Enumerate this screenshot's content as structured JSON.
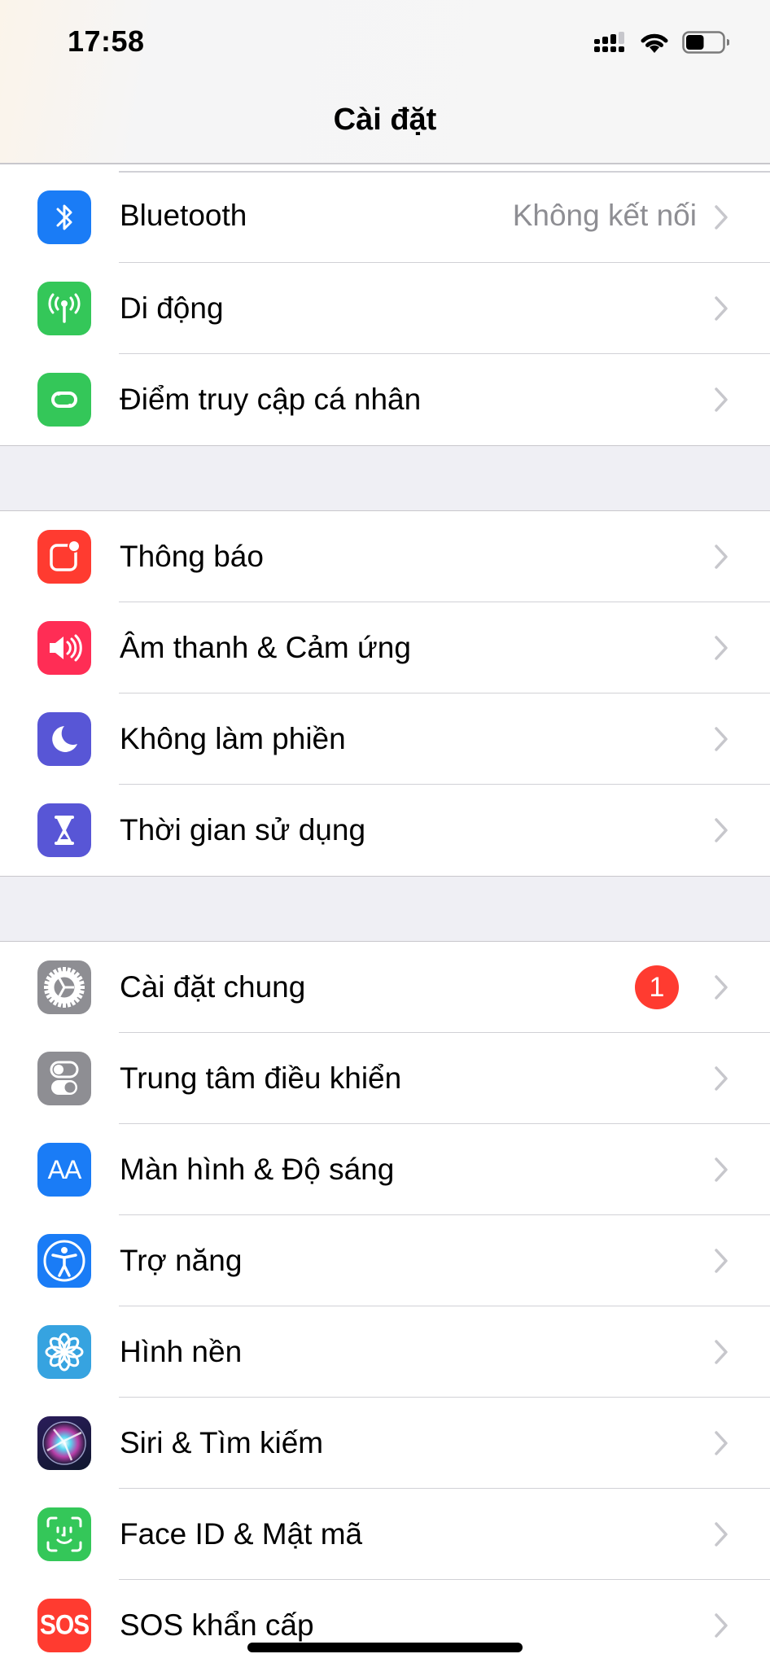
{
  "status_bar": {
    "time": "17:58",
    "signal_bars_active": 3,
    "signal_bars_total": 4,
    "battery_level": 0.5
  },
  "nav": {
    "title": "Cài đặt"
  },
  "sections": [
    {
      "rows": [
        {
          "label": "Bluetooth",
          "detail": "Không kết nối",
          "icon": "bluetooth-icon",
          "color": "#1a7cf6"
        },
        {
          "label": "Di động",
          "icon": "antenna-icon",
          "color": "#34c759"
        },
        {
          "label": "Điểm truy cập cá nhân",
          "icon": "hotspot-link-icon",
          "color": "#34c759"
        }
      ]
    },
    {
      "rows": [
        {
          "label": "Thông báo",
          "icon": "notifications-icon",
          "color": "#ff3b30"
        },
        {
          "label": "Âm thanh & Cảm ứng",
          "icon": "speaker-icon",
          "color": "#ff2d55"
        },
        {
          "label": "Không làm phiền",
          "icon": "moon-icon",
          "color": "#5856d6"
        },
        {
          "label": "Thời gian sử dụng",
          "icon": "hourglass-icon",
          "color": "#5856d6"
        }
      ]
    },
    {
      "rows": [
        {
          "label": "Cài đặt chung",
          "badge": "1",
          "icon": "gear-icon",
          "color": "#8e8e93"
        },
        {
          "label": "Trung tâm điều khiển",
          "icon": "toggles-icon",
          "color": "#8e8e93"
        },
        {
          "label": "Màn hình & Độ sáng",
          "icon": "text-size-icon",
          "color": "#1a7cf6",
          "glyph": "AA"
        },
        {
          "label": "Trợ năng",
          "icon": "accessibility-icon",
          "color": "#1a7cf6"
        },
        {
          "label": "Hình nền",
          "icon": "flower-icon",
          "color": "#36a3e0"
        },
        {
          "label": "Siri & Tìm kiếm",
          "icon": "siri-icon",
          "color": "#1c1c3c"
        },
        {
          "label": "Face ID & Mật mã",
          "icon": "face-id-icon",
          "color": "#34c759"
        },
        {
          "label": "SOS khẩn cấp",
          "icon": "sos-icon",
          "color": "#ff3b30",
          "glyph": "SOS"
        }
      ]
    }
  ],
  "colors": {
    "badge": "#ff3b30",
    "chevron": "#c7c7cc",
    "detail_text": "#8e8e93",
    "background": "#efeff4"
  }
}
